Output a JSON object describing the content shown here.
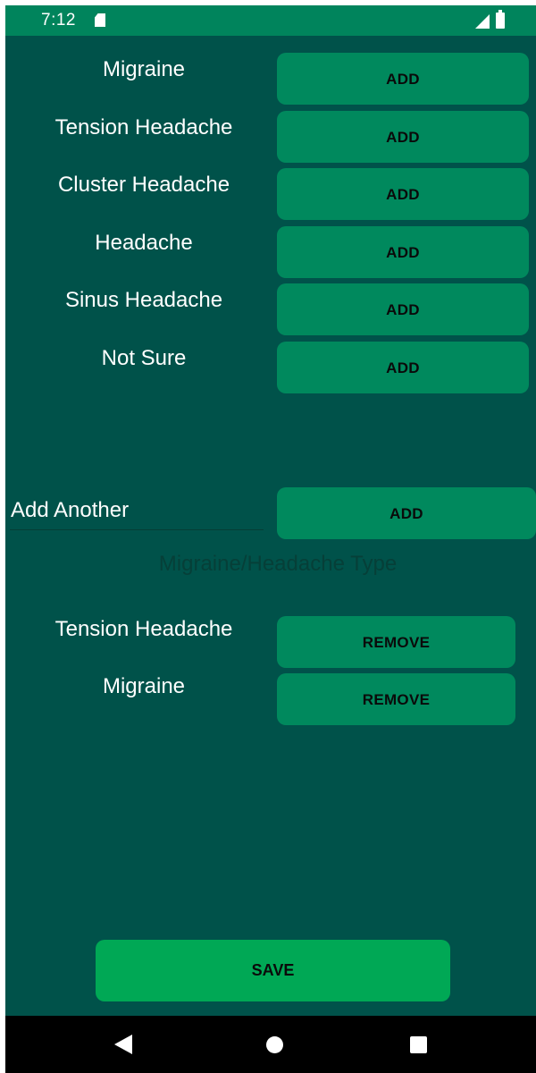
{
  "status_bar": {
    "time": "7:12",
    "icons": [
      "sd-card-icon",
      "signal-icon",
      "battery-icon"
    ]
  },
  "headache_types": [
    {
      "label": "Migraine",
      "button": "ADD"
    },
    {
      "label": "Tension Headache",
      "button": "ADD"
    },
    {
      "label": "Cluster Headache",
      "button": "ADD"
    },
    {
      "label": "Headache",
      "button": "ADD"
    },
    {
      "label": "Sinus Headache",
      "button": "ADD"
    },
    {
      "label": "Not Sure",
      "button": "ADD"
    }
  ],
  "add_another": {
    "value": "Add Another",
    "button": "ADD"
  },
  "section_title": "Migraine/Headache Type",
  "selected_types": [
    {
      "label": "Tension Headache",
      "button": "REMOVE"
    },
    {
      "label": "Migraine",
      "button": "REMOVE"
    }
  ],
  "save_label": "SAVE",
  "nav_bar": {
    "icons": [
      "back-icon",
      "home-icon",
      "recents-icon"
    ]
  },
  "colors": {
    "background": "#00524a",
    "status_bar": "#00845c",
    "button": "#00895d",
    "save_button": "#00a855",
    "section_title": "#063f38"
  }
}
